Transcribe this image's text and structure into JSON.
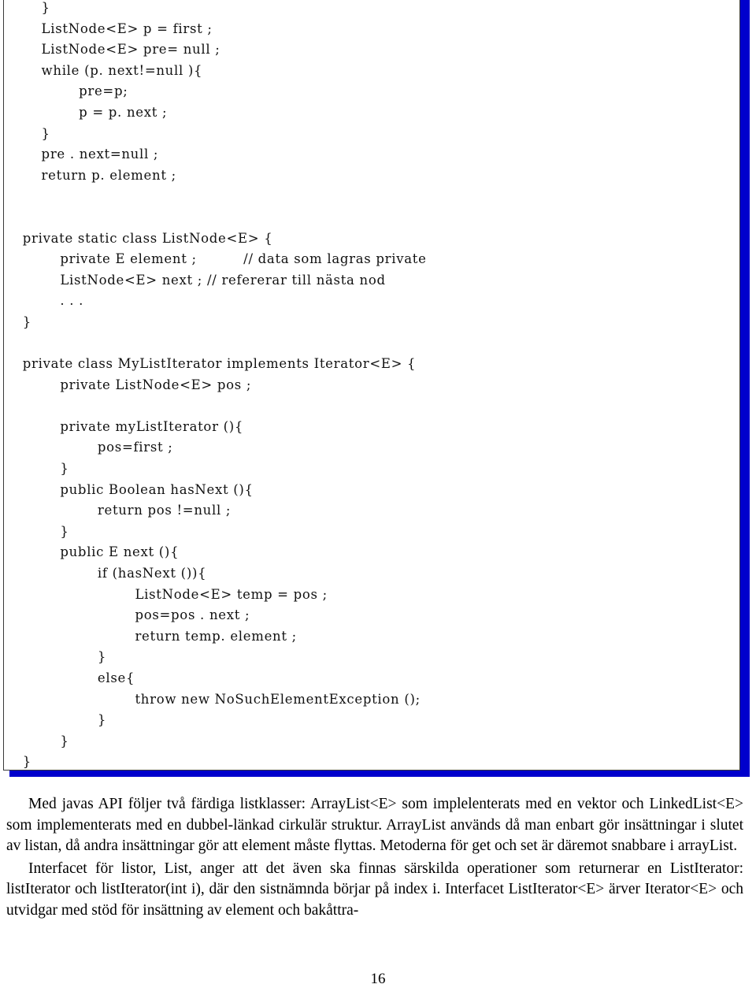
{
  "page": {
    "number": "16",
    "accent_color": "#0000cc",
    "box_border_color": "#3a3a3a",
    "text_color": "#000000"
  },
  "code_listing": {
    "name": "java-code-listing",
    "lines": [
      "        }",
      "        ListNode<E> p = first ;",
      "        ListNode<E> pre= null ;",
      "        while (p. next!=null ){",
      "                pre=p;",
      "                p = p. next ;",
      "        }",
      "        pre . next=null ;",
      "        return p. element ;",
      "",
      "",
      "    private static class ListNode<E> {",
      "            private E element ;          // data som lagras private",
      "            ListNode<E> next ; // refererar till nästa nod",
      "            . . .",
      "    }",
      "",
      "    private class MyListIterator implements Iterator<E> {",
      "            private ListNode<E> pos ;",
      "",
      "            private myListIterator (){",
      "                    pos=first ;",
      "            }",
      "            public Boolean hasNext (){",
      "                    return pos !=null ;",
      "            }",
      "            public E next (){",
      "                    if (hasNext ()){",
      "                            ListNode<E> temp = pos ;",
      "                            pos=pos . next ;",
      "                            return temp. element ;",
      "                    }",
      "                    else{",
      "                            throw new NoSuchElementException ();",
      "                    }",
      "            }",
      "    }",
      "}"
    ]
  },
  "prose": {
    "paragraphs": [
      "Med javas API följer två färdiga listklasser: ArrayList<E> som implelenterats med en vektor och LinkedList<E> som implementerats med en dubbel-länkad cirkulär struktur. ArrayList används då man enbart gör insättningar i slutet av listan, då andra insättningar gör att element måste flyttas. Metoderna för get och set är däremot snabbare i arrayList.",
      "Interfacet för listor, List, anger att det även ska finnas särskilda operationer som returnerar en ListIterator: listIterator och listIterator(int i), där den sistnämnda börjar på index i. Interfacet ListIterator<E> ärver Iterator<E> och utvidgar med stöd för insättning av element och bakåttra-"
    ]
  }
}
